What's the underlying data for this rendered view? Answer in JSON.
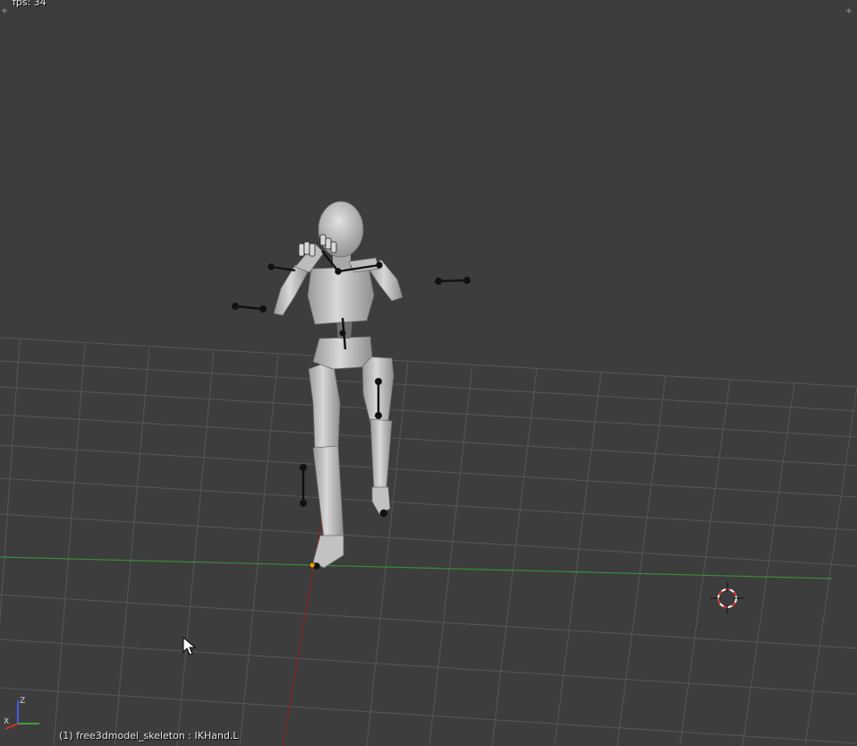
{
  "viewport": {
    "fps_text": "fps: 34",
    "object_info": "(1) free3dmodel_skeleton : IKHand.L",
    "axis_labels": {
      "x": "X",
      "z": "Z"
    }
  },
  "colors": {
    "background": "#3d3d3d",
    "grid_line": "#555555",
    "x_axis": "#7a1c1c",
    "y_axis": "#3b8a3b",
    "bone": "#111111",
    "mesh_light": "#cfcfcf",
    "mesh_dark": "#8a8a8a",
    "selected_bone_joint": "#e8a000",
    "cursor_red": "#e03030"
  },
  "icons": {
    "corner_widget": "plus-icon",
    "cursor": "arrow-pointer-icon",
    "3d_cursor": "crosshair-3d-cursor-icon",
    "gizmo": "axis-orientation-icon"
  }
}
